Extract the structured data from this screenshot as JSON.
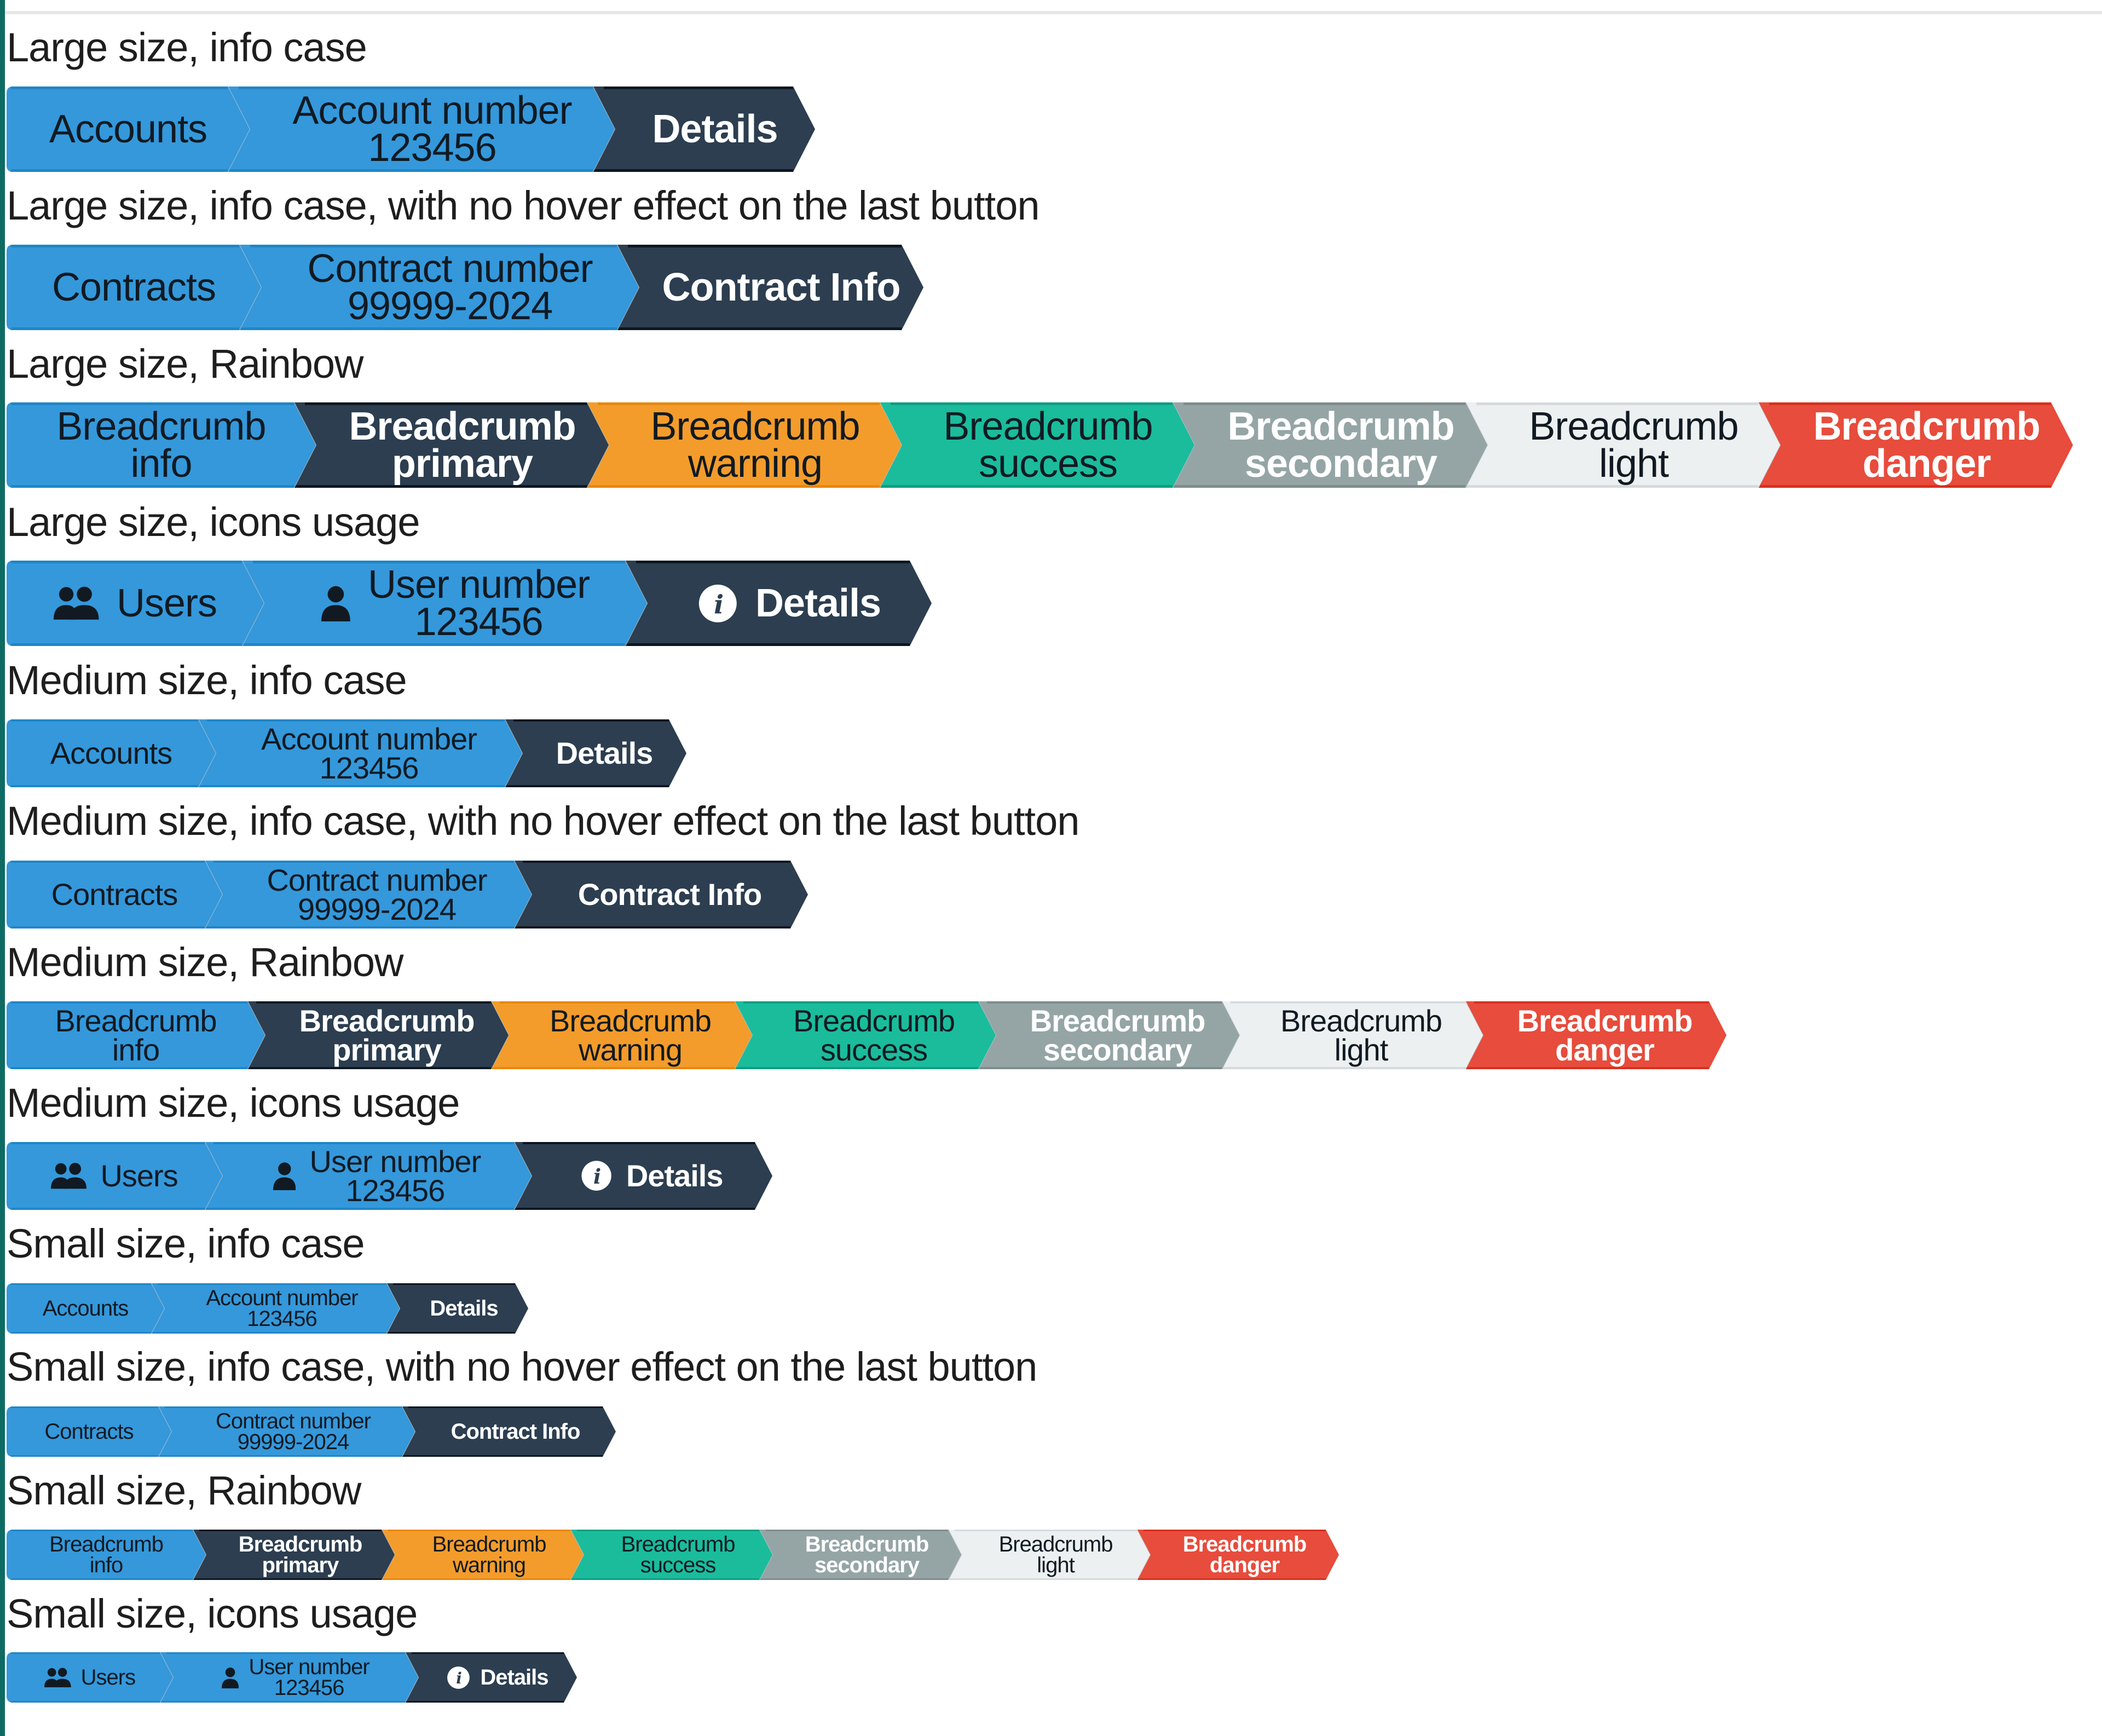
{
  "colors": {
    "info": "#3498db",
    "primary": "#2c3e50",
    "warning": "#f39c2b",
    "success": "#1abc9c",
    "secondary": "#95a5a6",
    "light": "#ecf0f1",
    "danger": "#e74c3c",
    "left_bar": "#0e6b64"
  },
  "sections": [
    {
      "label": "Large size, info case",
      "size": "lg",
      "items": [
        {
          "lines": [
            "Accounts"
          ],
          "variant": "info"
        },
        {
          "lines": [
            "Account number",
            "123456"
          ],
          "variant": "info"
        },
        {
          "lines": [
            "Details"
          ],
          "variant": "primary"
        }
      ]
    },
    {
      "label": "Large size, info case, with no hover effect on the last button",
      "size": "lg",
      "items": [
        {
          "lines": [
            "Contracts"
          ],
          "variant": "info"
        },
        {
          "lines": [
            "Contract number",
            "99999-2024"
          ],
          "variant": "info"
        },
        {
          "lines": [
            "Contract Info"
          ],
          "variant": "primary"
        }
      ]
    },
    {
      "label": "Large size, Rainbow",
      "size": "lg",
      "items": [
        {
          "lines": [
            "Breadcrumb",
            "info"
          ],
          "variant": "info"
        },
        {
          "lines": [
            "Breadcrumb",
            "primary"
          ],
          "variant": "primary"
        },
        {
          "lines": [
            "Breadcrumb",
            "warning"
          ],
          "variant": "warning"
        },
        {
          "lines": [
            "Breadcrumb",
            "success"
          ],
          "variant": "success"
        },
        {
          "lines": [
            "Breadcrumb",
            "secondary"
          ],
          "variant": "secondary"
        },
        {
          "lines": [
            "Breadcrumb",
            "light"
          ],
          "variant": "light"
        },
        {
          "lines": [
            "Breadcrumb",
            "danger"
          ],
          "variant": "danger"
        }
      ]
    },
    {
      "label": "Large size, icons usage",
      "size": "lg",
      "items": [
        {
          "lines": [
            "Users"
          ],
          "variant": "info",
          "icon": "users-icon"
        },
        {
          "lines": [
            "User number",
            "123456"
          ],
          "variant": "info",
          "icon": "user-icon"
        },
        {
          "lines": [
            "Details"
          ],
          "variant": "primary",
          "icon": "info-circle-icon"
        }
      ]
    },
    {
      "label": "Medium size, info case",
      "size": "md",
      "items": [
        {
          "lines": [
            "Accounts"
          ],
          "variant": "info"
        },
        {
          "lines": [
            "Account number",
            "123456"
          ],
          "variant": "info"
        },
        {
          "lines": [
            "Details"
          ],
          "variant": "primary"
        }
      ]
    },
    {
      "label": "Medium size, info case, with no hover effect on the last button",
      "size": "md",
      "items": [
        {
          "lines": [
            "Contracts"
          ],
          "variant": "info"
        },
        {
          "lines": [
            "Contract number",
            "99999-2024"
          ],
          "variant": "info"
        },
        {
          "lines": [
            "Contract Info"
          ],
          "variant": "primary"
        }
      ]
    },
    {
      "label": "Medium size, Rainbow",
      "size": "md",
      "items": [
        {
          "lines": [
            "Breadcrumb",
            "info"
          ],
          "variant": "info"
        },
        {
          "lines": [
            "Breadcrumb",
            "primary"
          ],
          "variant": "primary"
        },
        {
          "lines": [
            "Breadcrumb",
            "warning"
          ],
          "variant": "warning"
        },
        {
          "lines": [
            "Breadcrumb",
            "success"
          ],
          "variant": "success"
        },
        {
          "lines": [
            "Breadcrumb",
            "secondary"
          ],
          "variant": "secondary"
        },
        {
          "lines": [
            "Breadcrumb",
            "light"
          ],
          "variant": "light"
        },
        {
          "lines": [
            "Breadcrumb",
            "danger"
          ],
          "variant": "danger"
        }
      ]
    },
    {
      "label": "Medium size, icons usage",
      "size": "md",
      "items": [
        {
          "lines": [
            "Users"
          ],
          "variant": "info",
          "icon": "users-icon"
        },
        {
          "lines": [
            "User number",
            "123456"
          ],
          "variant": "info",
          "icon": "user-icon"
        },
        {
          "lines": [
            "Details"
          ],
          "variant": "primary",
          "icon": "info-circle-icon"
        }
      ]
    },
    {
      "label": "Small size, info case",
      "size": "sm",
      "items": [
        {
          "lines": [
            "Accounts"
          ],
          "variant": "info"
        },
        {
          "lines": [
            "Account number",
            "123456"
          ],
          "variant": "info"
        },
        {
          "lines": [
            "Details"
          ],
          "variant": "primary"
        }
      ]
    },
    {
      "label": "Small size, info case, with no hover effect on the last button",
      "size": "sm",
      "items": [
        {
          "lines": [
            "Contracts"
          ],
          "variant": "info"
        },
        {
          "lines": [
            "Contract number",
            "99999-2024"
          ],
          "variant": "info"
        },
        {
          "lines": [
            "Contract Info"
          ],
          "variant": "primary"
        }
      ]
    },
    {
      "label": "Small size, Rainbow",
      "size": "sm",
      "items": [
        {
          "lines": [
            "Breadcrumb",
            "info"
          ],
          "variant": "info"
        },
        {
          "lines": [
            "Breadcrumb",
            "primary"
          ],
          "variant": "primary"
        },
        {
          "lines": [
            "Breadcrumb",
            "warning"
          ],
          "variant": "warning"
        },
        {
          "lines": [
            "Breadcrumb",
            "success"
          ],
          "variant": "success"
        },
        {
          "lines": [
            "Breadcrumb",
            "secondary"
          ],
          "variant": "secondary"
        },
        {
          "lines": [
            "Breadcrumb",
            "light"
          ],
          "variant": "light"
        },
        {
          "lines": [
            "Breadcrumb",
            "danger"
          ],
          "variant": "danger"
        }
      ]
    },
    {
      "label": "Small size, icons usage",
      "size": "sm",
      "items": [
        {
          "lines": [
            "Users"
          ],
          "variant": "info",
          "icon": "users-icon"
        },
        {
          "lines": [
            "User number",
            "123456"
          ],
          "variant": "info",
          "icon": "user-icon"
        },
        {
          "lines": [
            "Details"
          ],
          "variant": "primary",
          "icon": "info-circle-icon"
        }
      ]
    }
  ]
}
